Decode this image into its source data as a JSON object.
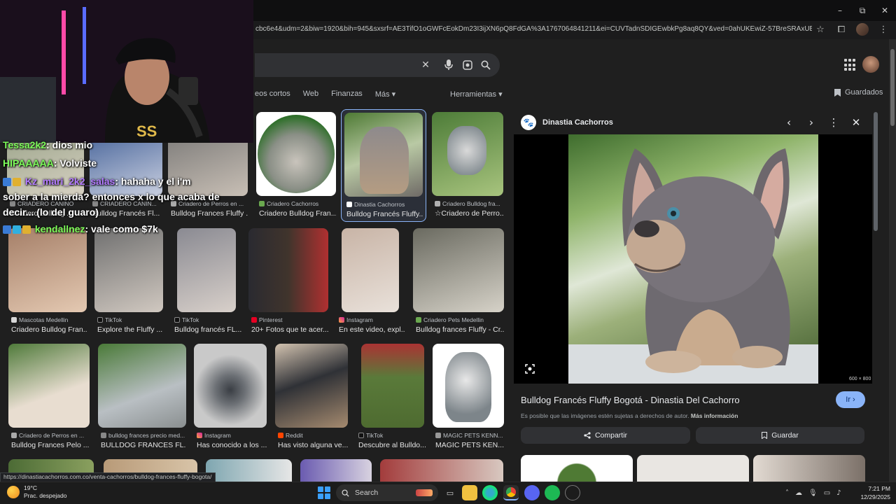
{
  "window": {
    "minimize": "–",
    "maximize": "⧉",
    "close": "✕"
  },
  "address_bar": {
    "url": "cbc6e4&udm=2&biw=1920&bih=945&sxsrf=AE3TifO1oGWFcEokDm23I3ijXN6pQ8FdGA%3A1767064841211&ei=CUVTadnSDIGEwbkPg8aq8QY&ved=0ahUKEwiZ-57BreSRAxUBQjABHQOjKm4..."
  },
  "search": {
    "clear_icon": "✕",
    "mic_icon": "🎤",
    "lens_icon": "⌾",
    "search_icon": "⌕"
  },
  "filters": {
    "tabs": [
      "eos cortos",
      "Web",
      "Finanzas",
      "Más ▾"
    ],
    "tools": "Herramientas ▾",
    "saved": "Guardados"
  },
  "results": {
    "row1": [
      {
        "source": "CRIADERO CANINO",
        "title": "Criadero Bulldog ..."
      },
      {
        "source": "CRIADERO CANIN...",
        "title": "Bulldog Francés Fl..."
      },
      {
        "source": "Criadero de Perros en ...",
        "title": "Bulldog Frances Fluffy ..."
      },
      {
        "source": "Criadero Cachorros",
        "title": "Criadero Bulldog Fran..."
      },
      {
        "source": "Dinastia Cachorros",
        "title": "Bulldog Francés Fluffy..."
      },
      {
        "source": "Criadero Bulldog fra...",
        "title": "☆Criadero de Perro..."
      }
    ],
    "row2": [
      {
        "source": "Mascotas Medellin",
        "title": "Criadero Bulldog Fran..."
      },
      {
        "source": "TikTok",
        "title": "Explore the Fluffy ..."
      },
      {
        "source": "TikTok",
        "title": "Bulldog francés FL..."
      },
      {
        "source": "Pinterest",
        "title": "20+ Fotos que te acer..."
      },
      {
        "source": "Instagram",
        "title": "En este video, expl..."
      },
      {
        "source": "Criadero Pets Medellin",
        "title": "Bulldog frances Fluffy - Cr..."
      }
    ],
    "row3": [
      {
        "source": "Criadero de Perros en ...",
        "title": "Bulldog Frances Pelo ..."
      },
      {
        "source": "bulldog frances precio med...",
        "title": "BULLDOG FRANCES FL..."
      },
      {
        "source": "Instagram",
        "title": "Has conocido a los ..."
      },
      {
        "source": "Reddit",
        "title": "Has visto alguna ve..."
      },
      {
        "source": "TikTok",
        "title": "Descubre al Bulldo..."
      },
      {
        "source": "MAGIC PETS KENN...",
        "title": "MAGIC PETS KEN..."
      }
    ]
  },
  "preview": {
    "source_name": "Dinastia Cachorros",
    "paw_icon": "🐾",
    "prev_icon": "‹",
    "next_icon": "›",
    "more_icon": "⋮",
    "close_icon": "✕",
    "dimensions": "600 × 800",
    "title": "Bulldog Francés Fluffy Bogotá - Dinastia Del Cachorro",
    "visit_label": "Ir ›",
    "copyright_text": "Es posible que las imágenes estén sujetas a derechos de autor.",
    "more_info": "Más información",
    "share_label": "Compartir",
    "save_label": "Guardar"
  },
  "chat": [
    {
      "user": "Tessa2k2",
      "text": ": dios mio"
    },
    {
      "user": "HIPAAAAA",
      "text": ": Volviste"
    },
    {
      "user": "Kz_mari_2k2_salas",
      "text": ": hahaha y el i'm"
    },
    {
      "user": "",
      "text": "sober a la mierda? entonces x lo que acaba de"
    },
    {
      "user": "",
      "text": "decir... (lo del guaro)"
    },
    {
      "user": "kendallnez",
      "text": ": vale como $7k"
    }
  ],
  "status_url": "https://dinastiacachorros.com.co/venta-cachorros/bulldog-frances-fluffy-bogota/",
  "taskbar": {
    "temperature": "19°C",
    "weather": "Prac. despejado",
    "search_label": "Search",
    "time": "7:21 PM",
    "date": "12/29/2025"
  },
  "colors": {
    "accent_blue": "#8ab4f8",
    "page_bg": "#1f1f1f",
    "chat_green": "#7CFC5A",
    "chat_purple": "#b37bff"
  }
}
